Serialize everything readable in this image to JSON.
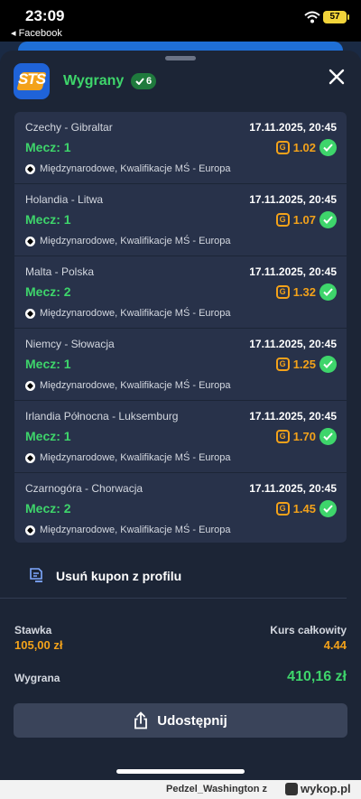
{
  "status_bar": {
    "time": "23:09",
    "back_app": "◂ Facebook",
    "battery": "57"
  },
  "header": {
    "title": "Wygrany",
    "badge_count": "6",
    "logo_text": "STS"
  },
  "bets": [
    {
      "teams": "Czechy - Gibraltar",
      "date": "17.11.2025, 20:45",
      "pick": "Mecz: 1",
      "odd": "1.02",
      "league": "Międzynarodowe, Kwalifikacje MŚ - Europa"
    },
    {
      "teams": "Holandia - Litwa",
      "date": "17.11.2025, 20:45",
      "pick": "Mecz: 1",
      "odd": "1.07",
      "league": "Międzynarodowe, Kwalifikacje MŚ - Europa"
    },
    {
      "teams": "Malta - Polska",
      "date": "17.11.2025, 20:45",
      "pick": "Mecz: 2",
      "odd": "1.32",
      "league": "Międzynarodowe, Kwalifikacje MŚ - Europa"
    },
    {
      "teams": "Niemcy - Słowacja",
      "date": "17.11.2025, 20:45",
      "pick": "Mecz: 1",
      "odd": "1.25",
      "league": "Międzynarodowe, Kwalifikacje MŚ - Europa"
    },
    {
      "teams": "Irlandia Północna - Luksemburg",
      "date": "17.11.2025, 20:45",
      "pick": "Mecz: 1",
      "odd": "1.70",
      "league": "Międzynarodowe, Kwalifikacje MŚ - Europa"
    },
    {
      "teams": "Czarnogóra - Chorwacja",
      "date": "17.11.2025, 20:45",
      "pick": "Mecz: 2",
      "odd": "1.45",
      "league": "Międzynarodowe, Kwalifikacje MŚ - Europa"
    }
  ],
  "remove_label": "Usuń kupon z profilu",
  "summary": {
    "stake_label": "Stawka",
    "stake_value": "105,00 zł",
    "odds_label": "Kurs całkowity",
    "odds_value": "4.44",
    "win_label": "Wygrana",
    "win_value": "410,16 zł"
  },
  "share_label": "Udostępnij",
  "footer": {
    "user": "Pedzel_Washington z",
    "site": "wykop.pl"
  },
  "colors": {
    "accent_green": "#3ed56b",
    "accent_orange": "#f3a21a",
    "sheet_bg": "#1c2536",
    "card_bg": "#28324a"
  }
}
